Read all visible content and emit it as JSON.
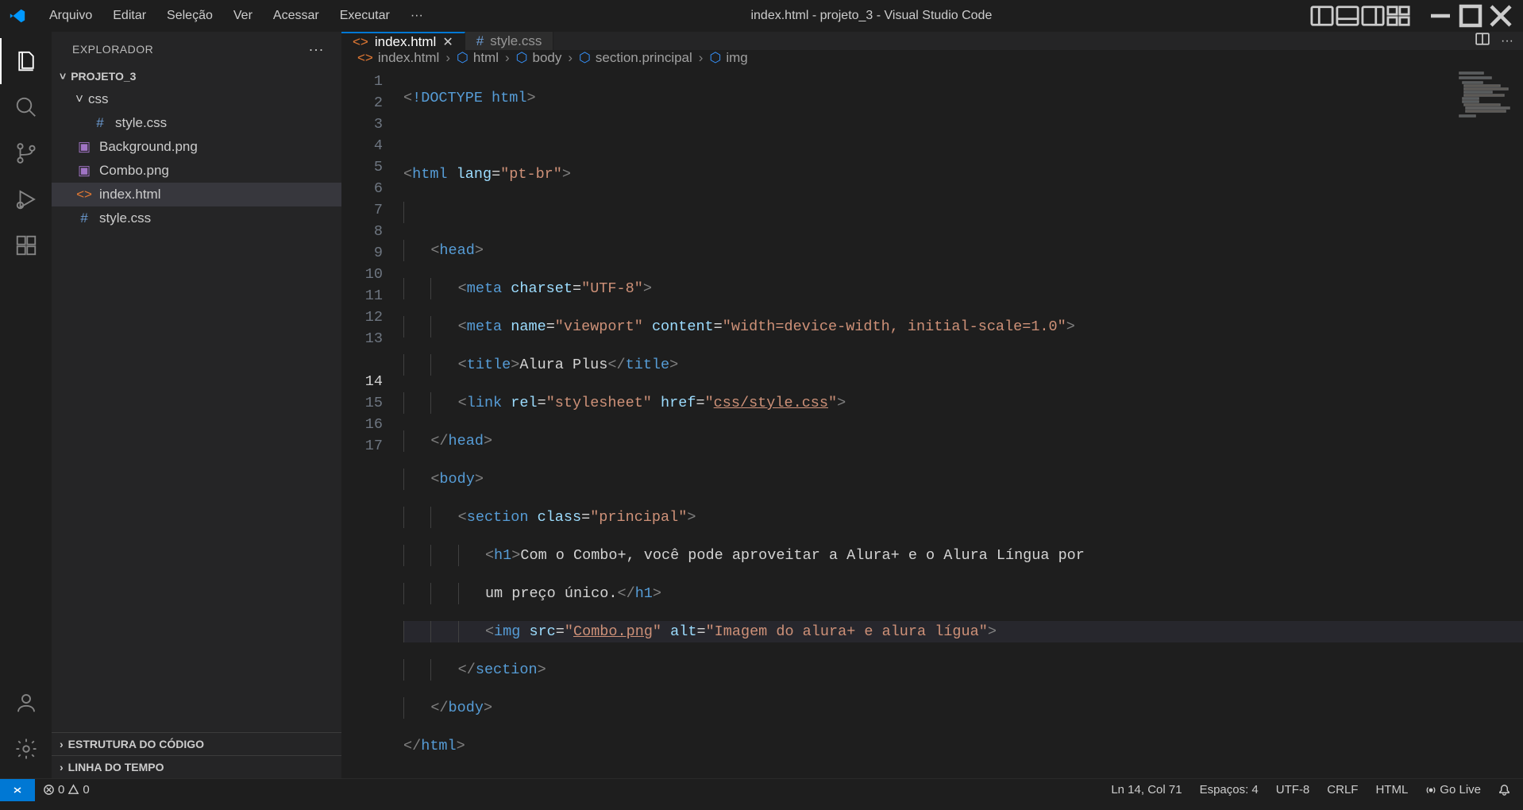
{
  "menu": {
    "arquivo": "Arquivo",
    "editar": "Editar",
    "selecao": "Seleção",
    "ver": "Ver",
    "acessar": "Acessar",
    "executar": "Executar",
    "more": "···"
  },
  "window_title": "index.html - projeto_3 - Visual Studio Code",
  "sidebar": {
    "title": "EXPLORADOR",
    "project": "PROJETO_3",
    "folders": {
      "css": "css"
    },
    "files": {
      "style_in_css": "style.css",
      "background": "Background.png",
      "combo": "Combo.png",
      "index": "index.html",
      "style_root": "style.css"
    },
    "outline": "ESTRUTURA DO CÓDIGO",
    "timeline": "LINHA DO TEMPO"
  },
  "tabs": {
    "index": "index.html",
    "style": "style.css"
  },
  "breadcrumb": {
    "file": "index.html",
    "html": "html",
    "body": "body",
    "section": "section.principal",
    "img": "img"
  },
  "code": {
    "l1_doctype": "!DOCTYPE",
    "l1_html": "html",
    "l3_html": "html",
    "l3_lang": "lang",
    "l3_langval": "\"pt-br\"",
    "l5_head": "head",
    "l6_meta": "meta",
    "l6_charset": "charset",
    "l6_charsetval": "\"UTF-8\"",
    "l7_meta": "meta",
    "l7_name": "name",
    "l7_nameval": "\"viewport\"",
    "l7_content": "content",
    "l7_contentval": "\"width=device-width, initial-scale=1.0\"",
    "l8_title": "title",
    "l8_text": "Alura Plus",
    "l9_link": "link",
    "l9_rel": "rel",
    "l9_relval": "\"stylesheet\"",
    "l9_href": "href",
    "l9_hrefval_q": "\"",
    "l9_hrefval": "css/style.css",
    "l10_head": "head",
    "l11_body": "body",
    "l12_section": "section",
    "l12_class": "class",
    "l12_classval": "\"principal\"",
    "l13_h1": "h1",
    "l13_text": "Com o Combo+, você pode aproveitar a Alura+ e o Alura Língua por ",
    "l13b_text": "um preço único.",
    "l14_img": "img",
    "l14_src": "src",
    "l14_srcval_q": "\"",
    "l14_srcval": "Combo.png",
    "l14_alt": "alt",
    "l14_altval": "\"Imagem do alura+ e alura lígua\"",
    "l15_section": "section",
    "l16_body": "body",
    "l17_html": "html"
  },
  "line_numbers": [
    "1",
    "2",
    "3",
    "4",
    "5",
    "6",
    "7",
    "8",
    "9",
    "10",
    "11",
    "12",
    "13",
    "",
    "14",
    "15",
    "16",
    "17"
  ],
  "statusbar": {
    "errors": "0",
    "warnings": "0",
    "cursor": "Ln 14, Col 71",
    "spaces": "Espaços: 4",
    "encoding": "UTF-8",
    "eol": "CRLF",
    "lang": "HTML",
    "golive": "Go Live"
  }
}
